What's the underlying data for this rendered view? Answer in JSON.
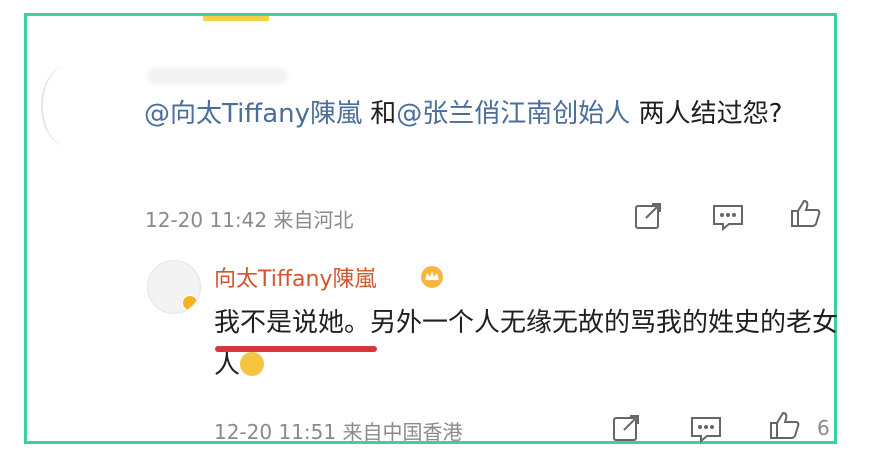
{
  "comment": {
    "mention1": "@向太Tiffany陳嵐",
    "connector": " 和",
    "mention2": "@张兰俏江南创始人",
    "text_tail": " 两人结过怨?",
    "meta": "12-20 11:42 来自河北"
  },
  "reply": {
    "username": "向太Tiffany陳嵐",
    "text": "我不是说她。另外一个人无缘无故的骂我的姓史的老女人",
    "meta": "12-20 11:51 来自中国香港",
    "like_count": "6"
  },
  "colors": {
    "frame": "#3fcf9a",
    "mention": "#4a6d9b",
    "username": "#d1562b",
    "underline": "#d9343a"
  },
  "icons": {
    "share": "share-icon",
    "comment": "comment-icon",
    "like": "thumbs-up-icon",
    "crown": "crown-badge-icon",
    "emoji": "smile-emoji-icon"
  }
}
